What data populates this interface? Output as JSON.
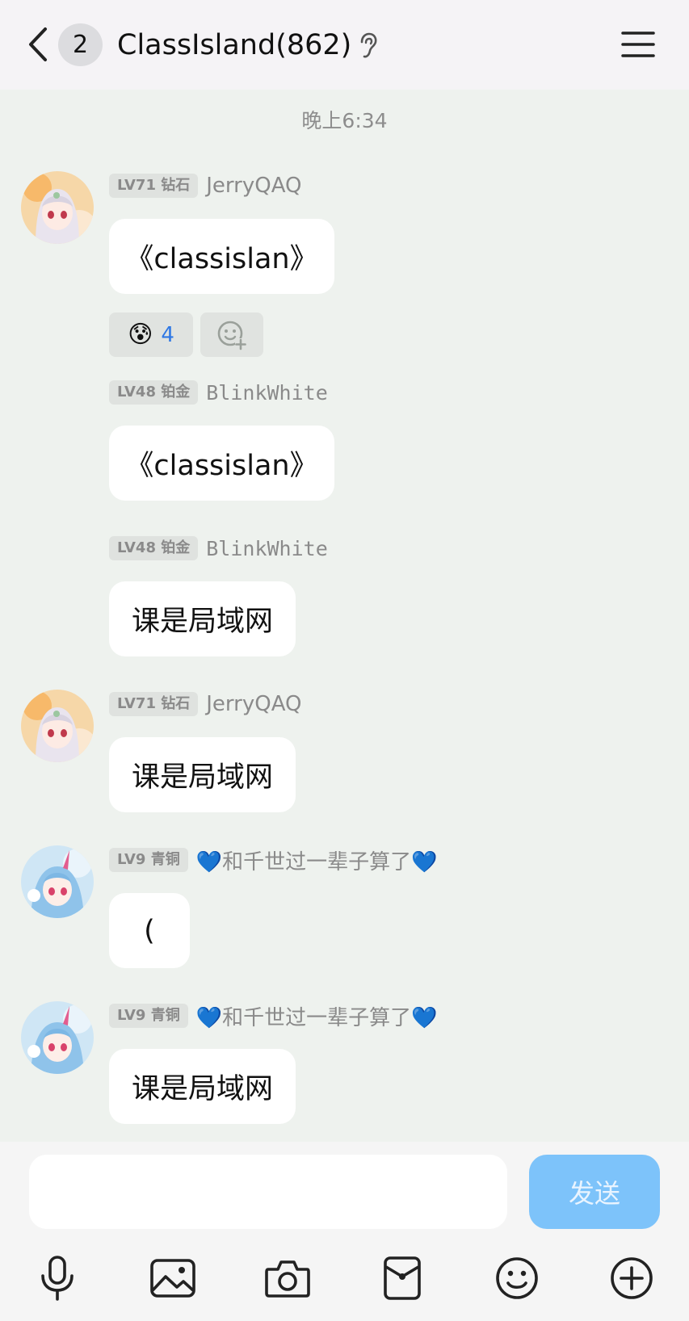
{
  "header": {
    "unread_count": "2",
    "title": "ClassIsland(862)"
  },
  "timestamp": "晚上6:34",
  "messages": [
    {
      "level": "LV71 钻石",
      "nick": "JerryQAQ",
      "text": "《classislan》"
    },
    {
      "level": "LV48 铂金",
      "nick": "BlinkWhite",
      "text": "《classislan》"
    },
    {
      "level": "LV48 铂金",
      "nick": "BlinkWhite",
      "text": "课是局域网"
    },
    {
      "level": "LV71 钻石",
      "nick": "JerryQAQ",
      "text": "课是局域网"
    },
    {
      "level": "LV9 青铜",
      "nick": "💙和千世过一辈子算了💙",
      "text": "("
    },
    {
      "level": "LV9 青铜",
      "nick": "💙和千世过一辈子算了💙",
      "text": "课是局域网"
    }
  ],
  "reaction": {
    "emoji": "😰",
    "count": "4"
  },
  "composer": {
    "placeholder": "",
    "send_label": "发送"
  },
  "toolbar_icons": [
    "microphone-icon",
    "image-icon",
    "camera-icon",
    "red-packet-icon",
    "emoji-icon",
    "plus-icon"
  ],
  "colors": {
    "chat_background": "#eef2ee",
    "send_button": "#7dc3fa",
    "reaction_count": "#2f78e4"
  }
}
